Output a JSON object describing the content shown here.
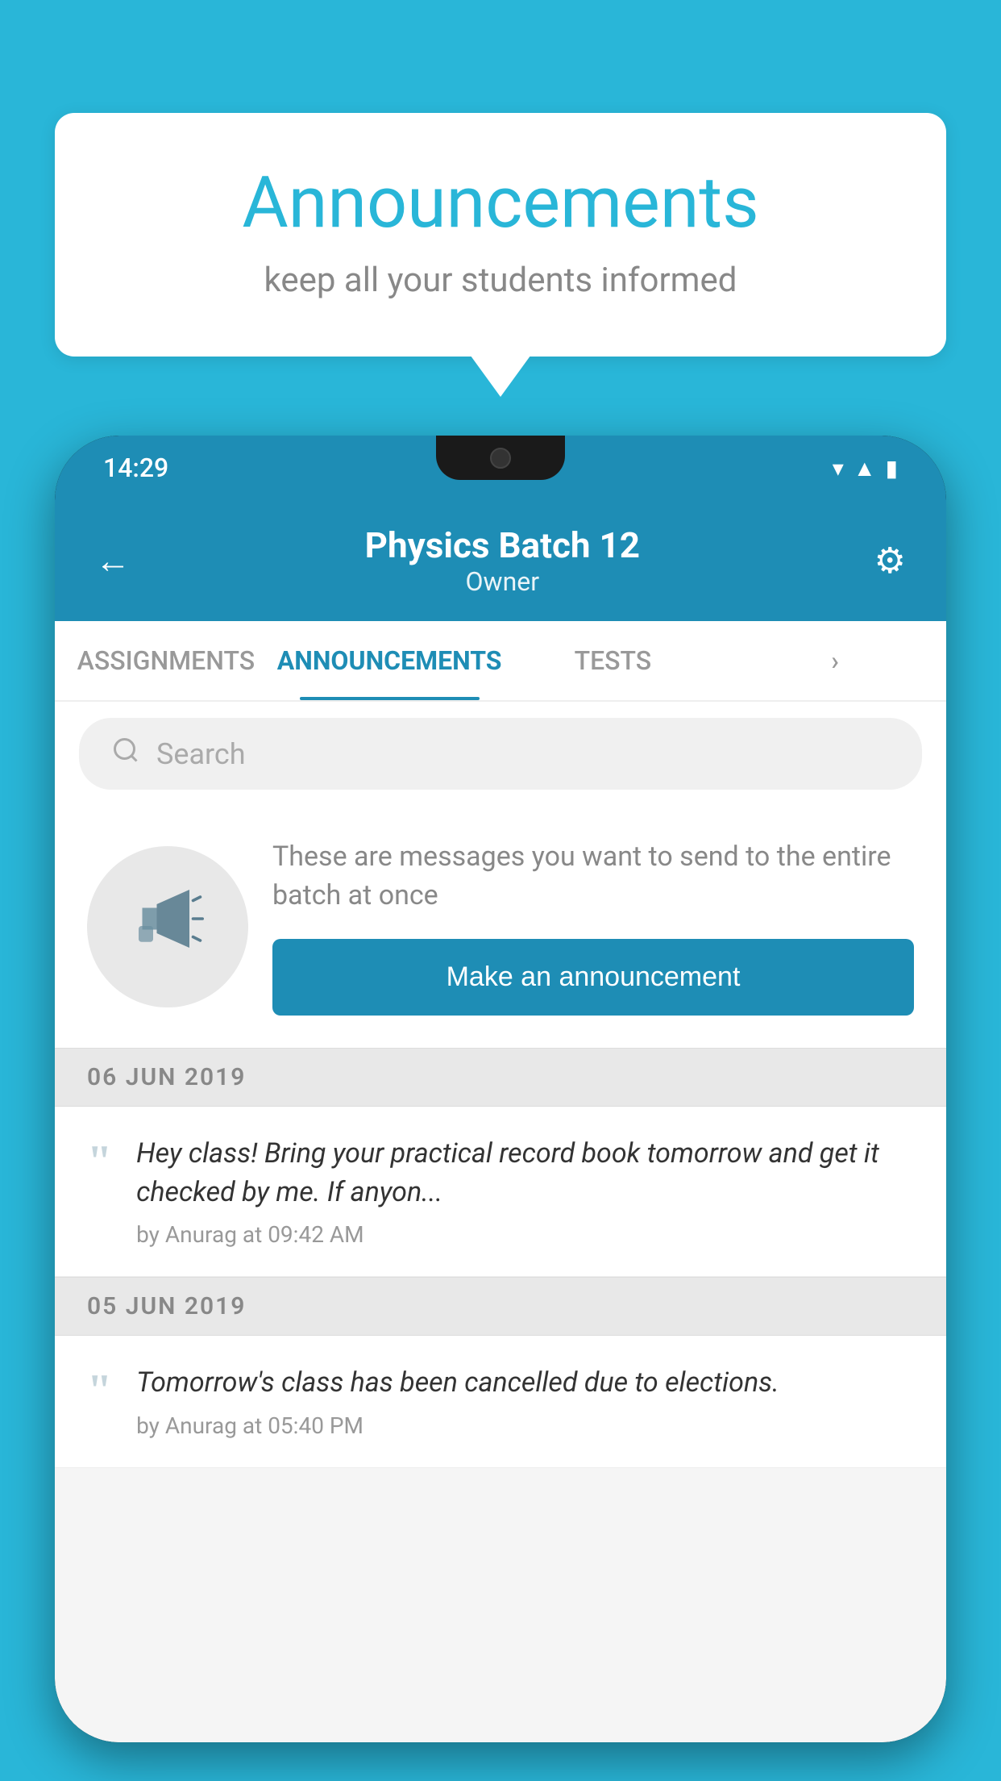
{
  "background_color": "#29b6d8",
  "speech_bubble": {
    "title": "Announcements",
    "subtitle": "keep all your students informed"
  },
  "phone": {
    "status_bar": {
      "time": "14:29",
      "icons": [
        "wifi",
        "signal",
        "battery"
      ]
    },
    "header": {
      "back_icon": "←",
      "title": "Physics Batch 12",
      "subtitle": "Owner",
      "gear_icon": "⚙"
    },
    "tabs": [
      {
        "label": "ASSIGNMENTS",
        "active": false
      },
      {
        "label": "ANNOUNCEMENTS",
        "active": true
      },
      {
        "label": "TESTS",
        "active": false
      },
      {
        "label": "···",
        "active": false
      }
    ],
    "search": {
      "placeholder": "Search",
      "icon": "🔍"
    },
    "promo": {
      "description": "These are messages you want to send to the entire batch at once",
      "button_label": "Make an announcement"
    },
    "announcements": [
      {
        "date": "06  JUN  2019",
        "text": "Hey class! Bring your practical record book tomorrow and get it checked by me. If anyon...",
        "meta": "by Anurag at 09:42 AM"
      },
      {
        "date": "05  JUN  2019",
        "text": "Tomorrow's class has been cancelled due to elections.",
        "meta": "by Anurag at 05:40 PM"
      }
    ]
  }
}
